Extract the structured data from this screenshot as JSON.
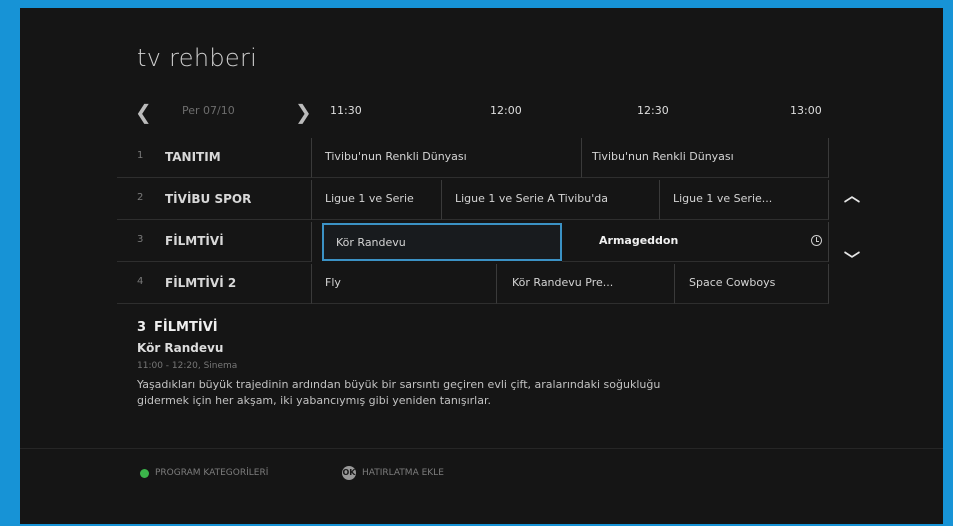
{
  "screen_title": "tv rehberi",
  "date_nav": {
    "prev_arrow": "❮",
    "date": "Per 07/10",
    "next_arrow": "❯"
  },
  "timeline": [
    "11:30",
    "12:00",
    "12:30",
    "13:00"
  ],
  "channels": [
    {
      "num": "1",
      "name": "TANITIM",
      "programs": [
        "Tivibu'nun Renkli Dünyası",
        "Tivibu'nun Renkli Dünyası"
      ]
    },
    {
      "num": "2",
      "name": "TİVİBU SPOR",
      "programs": [
        "Ligue 1 ve Serie",
        "Ligue 1 ve Serie A Tivibu'da",
        "Ligue 1 ve Serie..."
      ]
    },
    {
      "num": "3",
      "name": "FİLMTİVİ",
      "programs": [
        "Kör Randevu",
        "Armageddon"
      ]
    },
    {
      "num": "4",
      "name": "FİLMTİVİ 2",
      "programs": [
        "Fly",
        "Kör Randevu Pre...",
        "Space Cowboys"
      ]
    }
  ],
  "scroll": {
    "up": "︿",
    "down": "﹀"
  },
  "details": {
    "channel_num": "3",
    "channel_name": "FİLMTİVİ",
    "program_title": "Kör Randevu",
    "meta": "11:00 - 12:20, Sinema",
    "description": "Yaşadıkları büyük trajedinin ardından büyük bir sarsıntı geçiren evli çift, aralarındaki soğukluğu gidermek için her akşam, iki yabancıymış gibi yeniden tanışırlar."
  },
  "footer": {
    "categories_label": "PROGRAM KATEGORİLERİ",
    "categories_color": "#3bb54a",
    "reminder_icon": "OK",
    "reminder_label": "HATIRLATMA EKLE"
  }
}
